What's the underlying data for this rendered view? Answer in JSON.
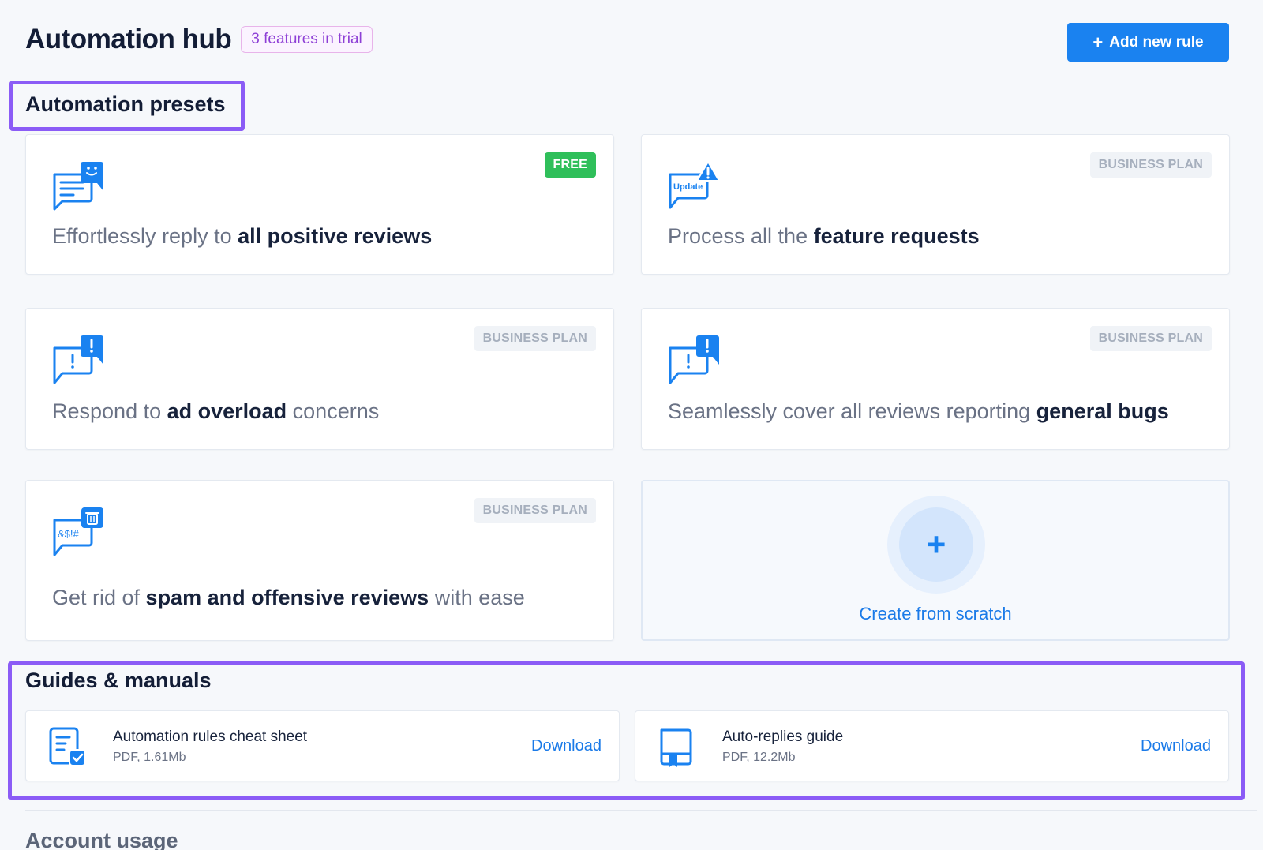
{
  "header": {
    "title": "Automation hub",
    "trial_badge": "3 features in trial",
    "add_rule_label": "Add new rule"
  },
  "sections": {
    "presets_title": "Automation presets",
    "guides_title": "Guides & manuals",
    "usage_title": "Account usage"
  },
  "presets": [
    {
      "badge": "FREE",
      "icon": "chat-smile-icon",
      "pre": "Effortlessly reply to ",
      "bold": "all positive reviews",
      "post": ""
    },
    {
      "badge": "BUSINESS PLAN",
      "icon": "update-alert-icon",
      "pre": "Process all the ",
      "bold": "feature requests",
      "post": ""
    },
    {
      "badge": "BUSINESS PLAN",
      "icon": "chat-alert-icon",
      "pre": "Respond to ",
      "bold": "ad overload",
      "post": " concerns"
    },
    {
      "badge": "BUSINESS PLAN",
      "icon": "chat-alert-icon",
      "pre": "Seamlessly cover all reviews reporting ",
      "bold": "general bugs",
      "post": ""
    },
    {
      "badge": "BUSINESS PLAN",
      "icon": "chat-trash-icon",
      "pre": "Get rid of ",
      "bold": "spam and offensive reviews",
      "post": " with ease"
    }
  ],
  "create_scratch": {
    "label": "Create from scratch"
  },
  "guides": [
    {
      "icon": "document-check-icon",
      "name": "Automation rules cheat sheet",
      "meta": "PDF, 1.61Mb",
      "action": "Download"
    },
    {
      "icon": "book-icon",
      "name": "Auto-replies guide",
      "meta": "PDF, 12.2Mb",
      "action": "Download"
    }
  ],
  "icon_text": {
    "update": "Update",
    "symbols": "&$!#"
  },
  "colors": {
    "accent": "#1a82f0",
    "highlight": "#8b5cf6",
    "free_badge": "#2fbf5a",
    "trial_badge": "#8e3fd6"
  }
}
